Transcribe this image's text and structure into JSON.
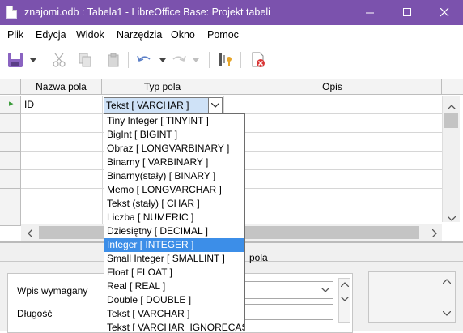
{
  "window": {
    "title": "znajomi.odb : Tabela1 - LibreOffice Base: Projekt tabeli",
    "minimize": "—",
    "maximize": "☐",
    "close": "✕"
  },
  "menu": [
    "Plik",
    "Edycja",
    "Widok",
    "Narzędzia",
    "Okno",
    "Pomoc"
  ],
  "grid": {
    "columns": [
      "Nazwa pola",
      "Typ pola",
      "Opis"
    ],
    "row_marker": "▸",
    "rows": [
      {
        "name": "ID",
        "type": "Tekst [ VARCHAR ]",
        "desc": ""
      }
    ]
  },
  "dropdown": {
    "options": [
      "Tiny Integer [ TINYINT ]",
      "BigInt [ BIGINT ]",
      "Obraz [ LONGVARBINARY ]",
      "Binarny [ VARBINARY ]",
      "Binarny(stały) [ BINARY ]",
      "Memo [ LONGVARCHAR ]",
      "Tekst (stały) [ CHAR ]",
      "Liczba [ NUMERIC ]",
      "Dziesiętny [ DECIMAL ]",
      "Integer [ INTEGER ]",
      "Small Integer [ SMALLINT ]",
      "Float [ FLOAT ]",
      "Real [ REAL ]",
      "Double [ DOUBLE ]",
      "Tekst [ VARCHAR ]",
      "Tekst [ VARCHAR_IGNORECASE ]"
    ],
    "selected": "Integer [ INTEGER ]"
  },
  "properties": {
    "section_label_visible": "pola",
    "required_label": "Wpis wymagany",
    "length_label": "Długość"
  },
  "colors": {
    "titlebar": "#7b52ad",
    "selection": "#3c8ee8"
  }
}
